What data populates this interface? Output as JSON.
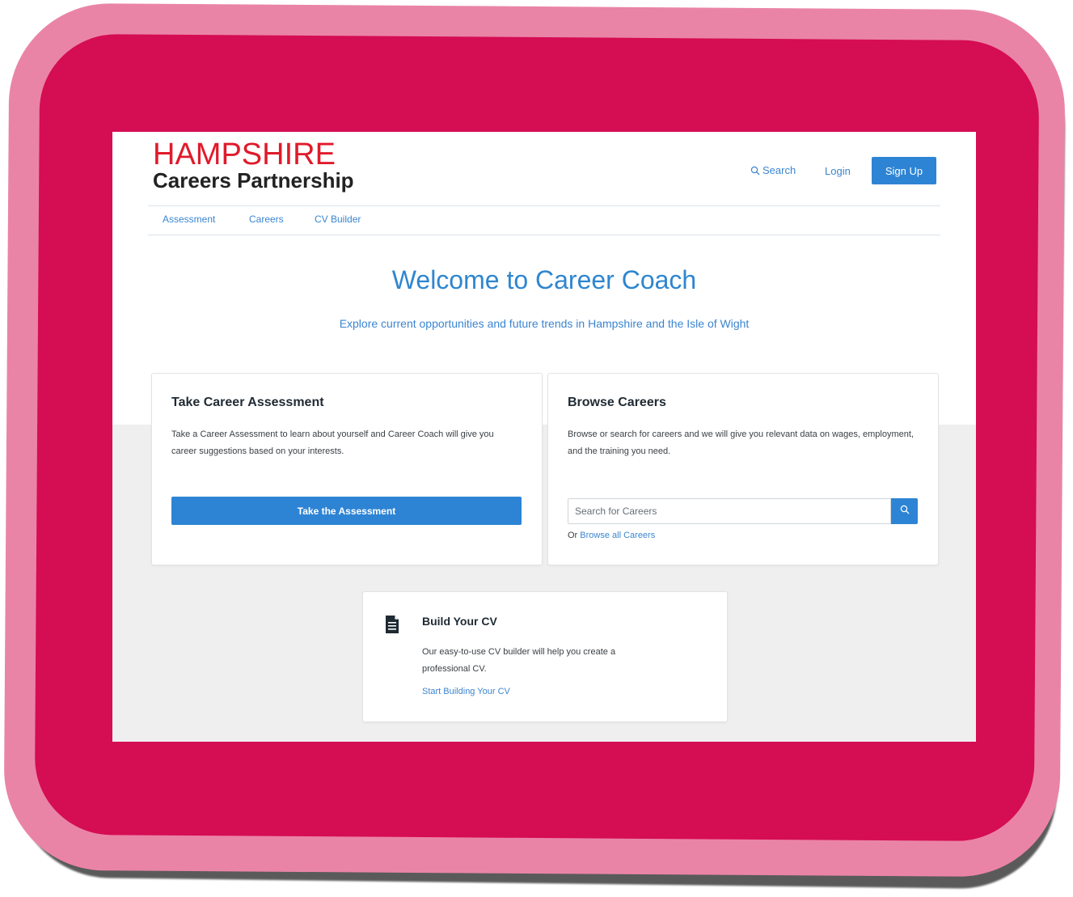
{
  "logo": {
    "line1": "HAMPSHIRE",
    "line2": "Careers Partnership"
  },
  "header": {
    "search_label": "Search",
    "login_label": "Login",
    "signup_label": "Sign Up"
  },
  "nav": {
    "items": [
      {
        "label": "Assessment"
      },
      {
        "label": "Careers"
      },
      {
        "label": "CV Builder"
      }
    ]
  },
  "hero": {
    "title": "Welcome to Career Coach",
    "subtitle": "Explore current opportunities and future trends in Hampshire and the Isle of Wight"
  },
  "assessment_card": {
    "title": "Take Career Assessment",
    "text": "Take a Career Assessment to learn about yourself and Career Coach will give you career suggestions based on your interests.",
    "button_label": "Take the Assessment"
  },
  "browse_card": {
    "title": "Browse Careers",
    "text": "Browse or search for careers and we will give you relevant data on wages, employment, and the training you need.",
    "search_placeholder": "Search for Careers",
    "or_label": "Or",
    "browse_all_label": "Browse all Careers"
  },
  "cv_card": {
    "title": "Build Your CV",
    "text": "Our easy-to-use CV builder will help you create a professional CV.",
    "link_label": "Start Building Your CV"
  },
  "colors": {
    "frame_outer": "#ea84a6",
    "frame_inner": "#d50d53",
    "brand_red": "#e01a2a",
    "accent_blue": "#2e84d4",
    "link_blue": "#3b85d0"
  },
  "icons": {
    "search": "search-icon",
    "document": "document-icon"
  }
}
